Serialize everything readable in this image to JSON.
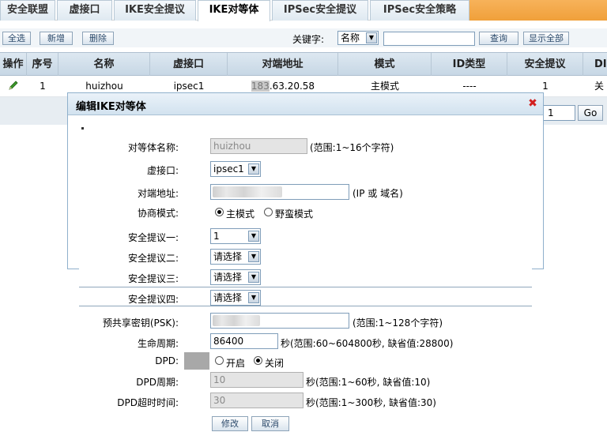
{
  "tabs": [
    {
      "label": "安全联盟",
      "active": false
    },
    {
      "label": "虚接口",
      "active": false
    },
    {
      "label": "IKE安全提议",
      "active": false
    },
    {
      "label": "IKE对等体",
      "active": true
    },
    {
      "label": "IPSec安全提议",
      "active": false
    },
    {
      "label": "IPSec安全策略",
      "active": false
    }
  ],
  "toolbar": {
    "select_all": "全选",
    "add": "新增",
    "delete": "删除",
    "keyword_label": "关键字:",
    "keyword_field": "名称",
    "search": "查询",
    "show_all": "显示全部"
  },
  "table": {
    "headers": [
      "操作",
      "序号",
      "名称",
      "虚接口",
      "对端地址",
      "模式",
      "ID类型",
      "安全提议",
      "DI"
    ],
    "row": {
      "index": "1",
      "name": "huizhou",
      "vif": "ipsec1",
      "peer_prefix": "183",
      "peer_rest": ".63.20.58",
      "mode": "主模式",
      "id_type": "----",
      "proposal": "1",
      "dpd_trunc": "关"
    }
  },
  "pager": {
    "page": "1",
    "go": "Go"
  },
  "dialog": {
    "title": "编辑IKE对等体",
    "fields": {
      "peer_name_label": "对等体名称:",
      "peer_name_value": "huizhou",
      "peer_name_hint": "(范围:1~16个字符)",
      "vif_label": "虚接口:",
      "vif_value": "ipsec1",
      "peer_addr_label": "对端地址:",
      "peer_addr_hint": "(IP 或 域名)",
      "nego_label": "协商模式:",
      "nego_main": "主模式",
      "nego_aggr": "野蛮模式",
      "p1_label": "安全提议一:",
      "p1_value": "1",
      "p2_label": "安全提议二:",
      "p2_value": "请选择",
      "p3_label": "安全提议三:",
      "p3_value": "请选择",
      "p4_label": "安全提议四:",
      "p4_value": "请选择",
      "psk_label": "预共享密钥(PSK):",
      "psk_hint": "(范围:1~128个字符)",
      "life_label": "生命周期:",
      "life_value": "86400",
      "life_hint": "秒(范围:60~604800秒, 缺省值:28800)",
      "dpd_label": "DPD:",
      "dpd_on": "开启",
      "dpd_off": "关闭",
      "dpd_period_label": "DPD周期:",
      "dpd_period_value": "10",
      "dpd_period_hint": "秒(范围:1~60秒, 缺省值:10)",
      "dpd_timeout_label": "DPD超时时间:",
      "dpd_timeout_value": "30",
      "dpd_timeout_hint": "秒(范围:1~300秒, 缺省值:30)"
    },
    "modify": "修改",
    "cancel": "取消"
  },
  "colors": {
    "accent_orange": "#f0a03a",
    "close_red": "#d21f1f",
    "header_blue": "#c7d7e5"
  }
}
